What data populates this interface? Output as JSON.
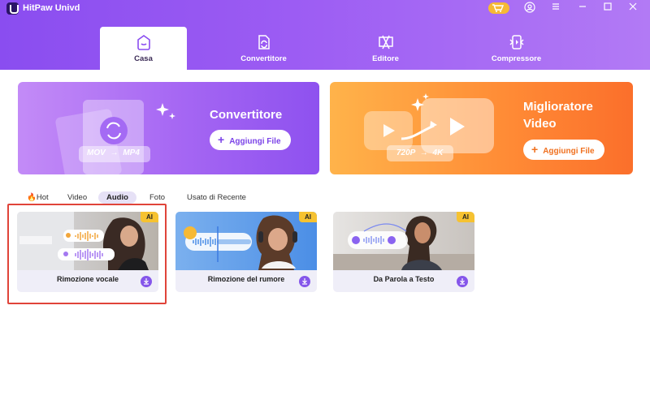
{
  "app": {
    "title": "HitPaw Univd"
  },
  "tabs": [
    {
      "label": "Casa",
      "icon": "home-icon"
    },
    {
      "label": "Convertitore",
      "icon": "convert-icon"
    },
    {
      "label": "Editore",
      "icon": "edit-icon"
    },
    {
      "label": "Compressore",
      "icon": "compress-icon"
    }
  ],
  "banners": {
    "left": {
      "title": "Convertitore",
      "button": "Aggiungi File",
      "format_from": "MOV",
      "format_to": "MP4"
    },
    "right": {
      "title_line1": "Miglioratore",
      "title_line2": "Video",
      "button": "Aggiungi File",
      "res_from": "720P",
      "res_to": "4K"
    }
  },
  "categories": [
    {
      "label": "Hot",
      "icon": "fire-icon"
    },
    {
      "label": "Video"
    },
    {
      "label": "Audio",
      "active": true
    },
    {
      "label": "Foto"
    },
    {
      "label": "Usato di Recente"
    }
  ],
  "cards": [
    {
      "label": "Rimozione vocale",
      "badge": "AI"
    },
    {
      "label": "Rimozione del rumore",
      "badge": "AI"
    },
    {
      "label": "Da Parola a Testo",
      "badge": "AI"
    }
  ],
  "arrow": "→",
  "colors": {
    "header": "#9c5cf3",
    "accent": "#8556ea",
    "orange": "#ff8a35",
    "badge": "#f6c231",
    "selection": "#e0443a"
  }
}
